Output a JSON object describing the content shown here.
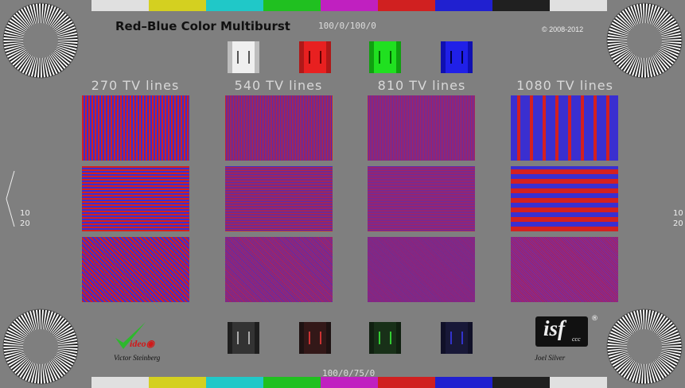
{
  "title": "Red–Blue Color Multiburst",
  "top_code": "100/0/100/0",
  "bottom_code": "100/0/75/0",
  "copyright": "© 2008-2012",
  "tv_lines": [
    "270 TV lines",
    "540 TV lines",
    "810 TV lines",
    "1080 TV lines"
  ],
  "side_marks": {
    "left": [
      "10",
      "20"
    ],
    "right": [
      "10",
      "20"
    ]
  },
  "logos": {
    "left_name": "Victor Steinberg",
    "right_name": "Joel Silver",
    "right_brand": "isf",
    "right_sub": "ccc",
    "registered": "®"
  },
  "colors": {
    "background": "#7f7f7f",
    "red": "#d42020",
    "blue": "#3a2fd0",
    "top_bars": [
      "#e0e0e0",
      "#d4d020",
      "#20c8c8",
      "#20c020",
      "#c020c0",
      "#d02020",
      "#2020d0",
      "#202020",
      "#e0e0e0"
    ]
  },
  "swatches_top": [
    "white-swatch",
    "red-swatch",
    "green-swatch",
    "blue-swatch"
  ],
  "swatches_bottom": [
    "dark-gray-swatch",
    "dark-red-swatch",
    "dark-green-swatch",
    "dark-blue-swatch"
  ]
}
